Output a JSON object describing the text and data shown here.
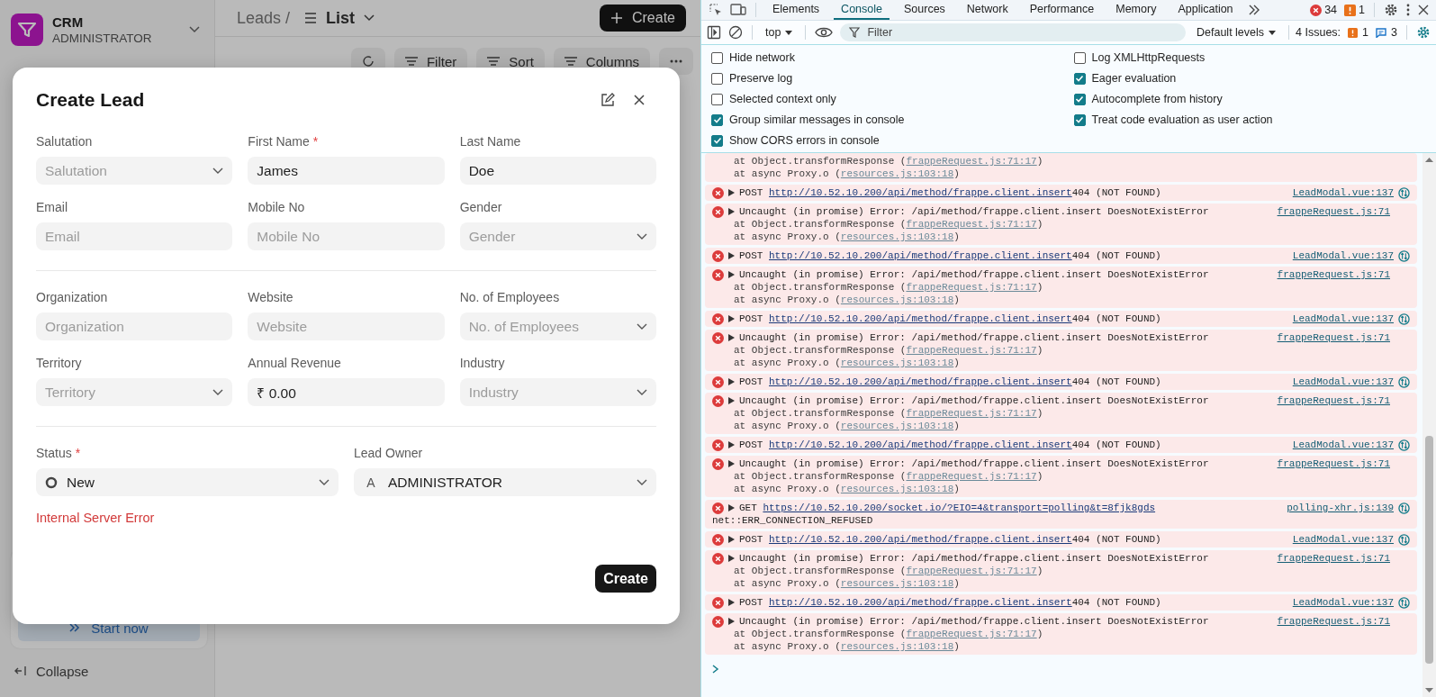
{
  "sidebar": {
    "app_name": "CRM",
    "user": "ADMINISTRATOR",
    "start_now": "Start now",
    "collapse": "Collapse"
  },
  "header": {
    "breadcrumb": "Leads /",
    "view": "List",
    "create": "Create"
  },
  "toolbar": [
    {
      "label": "Filter"
    },
    {
      "label": "Sort"
    },
    {
      "label": "Columns"
    }
  ],
  "dialog": {
    "title": "Create Lead",
    "sections": [
      {
        "fields": [
          {
            "label": "Salutation",
            "kind": "select",
            "placeholder": "Salutation"
          },
          {
            "label": "First Name",
            "mark": "*",
            "kind": "text",
            "value": "James"
          },
          {
            "label": "Last Name",
            "kind": "text",
            "value": "Doe"
          },
          {
            "label": "Email",
            "kind": "text",
            "placeholder": "Email"
          },
          {
            "label": "Mobile No",
            "kind": "text",
            "placeholder": "Mobile No"
          },
          {
            "label": "Gender",
            "kind": "select",
            "placeholder": "Gender"
          }
        ]
      },
      {
        "fields": [
          {
            "label": "Organization",
            "kind": "text",
            "placeholder": "Organization"
          },
          {
            "label": "Website",
            "kind": "text",
            "placeholder": "Website"
          },
          {
            "label": "No. of Employees",
            "kind": "select",
            "placeholder": "No. of Employees"
          },
          {
            "label": "Territory",
            "kind": "select",
            "placeholder": "Territory"
          },
          {
            "label": "Annual Revenue",
            "kind": "text",
            "value": "₹ 0.00"
          },
          {
            "label": "Industry",
            "kind": "select",
            "placeholder": "Industry"
          }
        ]
      },
      {
        "fields": [
          {
            "label": "Status",
            "mark": "*",
            "kind": "status",
            "value": "New"
          },
          {
            "label": "Lead Owner",
            "kind": "user",
            "avatar": "A",
            "value": "ADMINISTRATOR"
          }
        ]
      }
    ],
    "error": "Internal Server Error",
    "submit": "Create"
  },
  "devtools": {
    "tabs": [
      {
        "label": "Elements",
        "selected": false
      },
      {
        "label": "Console",
        "selected": true
      },
      {
        "label": "Sources",
        "selected": false
      },
      {
        "label": "Network",
        "selected": false
      },
      {
        "label": "Performance",
        "selected": false
      },
      {
        "label": "Memory",
        "selected": false
      },
      {
        "label": "Application",
        "selected": false
      }
    ],
    "errors": "34",
    "warnings": "1",
    "context": "top",
    "filter_placeholder": "Filter",
    "levels": "Default levels",
    "issues_label": "4 Issues:",
    "issue_warnings": "1",
    "issue_infos": "3",
    "settings": [
      {
        "label": "Hide network",
        "checked": false
      },
      {
        "label": "Log XMLHttpRequests",
        "checked": false
      },
      {
        "label": "Preserve log",
        "checked": false
      },
      {
        "label": "Eager evaluation",
        "checked": true
      },
      {
        "label": "Selected context only",
        "checked": false
      },
      {
        "label": "Autocomplete from history",
        "checked": true
      },
      {
        "label": "Group similar messages in console",
        "checked": true
      },
      {
        "label": "Treat code evaluation as user action",
        "checked": true
      },
      {
        "label": "Show CORS errors in console",
        "checked": true
      }
    ],
    "messages": [
      {
        "kind": "stack",
        "stack": [
          {
            "prefix": "at Object.transformResponse (",
            "link": "frappeRequest.js:71:17",
            "suffix": ")"
          },
          {
            "prefix": "at async Proxy.o (",
            "link": "resources.js:103:18",
            "suffix": ")"
          }
        ]
      },
      {
        "kind": "request",
        "method": "POST",
        "url": "http://10.52.10.200/api/method/frappe.client.insert",
        "status": "404 (NOT FOUND)",
        "source": "LeadModal.vue:137"
      },
      {
        "kind": "exception",
        "text": "Uncaught (in promise) Error: /api/method/frappe.client.insert DoesNotExistError",
        "source": "frappeRequest.js:71",
        "stack": [
          {
            "prefix": "at Object.transformResponse (",
            "link": "frappeRequest.js:71:17",
            "suffix": ")"
          },
          {
            "prefix": "at async Proxy.o (",
            "link": "resources.js:103:18",
            "suffix": ")"
          }
        ]
      },
      {
        "kind": "request",
        "method": "POST",
        "url": "http://10.52.10.200/api/method/frappe.client.insert",
        "status": "404 (NOT FOUND)",
        "source": "LeadModal.vue:137"
      },
      {
        "kind": "exception",
        "text": "Uncaught (in promise) Error: /api/method/frappe.client.insert DoesNotExistError",
        "source": "frappeRequest.js:71",
        "stack": [
          {
            "prefix": "at Object.transformResponse (",
            "link": "frappeRequest.js:71:17",
            "suffix": ")"
          },
          {
            "prefix": "at async Proxy.o (",
            "link": "resources.js:103:18",
            "suffix": ")"
          }
        ]
      },
      {
        "kind": "request",
        "method": "POST",
        "url": "http://10.52.10.200/api/method/frappe.client.insert",
        "status": "404 (NOT FOUND)",
        "source": "LeadModal.vue:137"
      },
      {
        "kind": "exception",
        "text": "Uncaught (in promise) Error: /api/method/frappe.client.insert DoesNotExistError",
        "source": "frappeRequest.js:71",
        "stack": [
          {
            "prefix": "at Object.transformResponse (",
            "link": "frappeRequest.js:71:17",
            "suffix": ")"
          },
          {
            "prefix": "at async Proxy.o (",
            "link": "resources.js:103:18",
            "suffix": ")"
          }
        ]
      },
      {
        "kind": "request",
        "method": "POST",
        "url": "http://10.52.10.200/api/method/frappe.client.insert",
        "status": "404 (NOT FOUND)",
        "source": "LeadModal.vue:137"
      },
      {
        "kind": "exception",
        "text": "Uncaught (in promise) Error: /api/method/frappe.client.insert DoesNotExistError",
        "source": "frappeRequest.js:71",
        "stack": [
          {
            "prefix": "at Object.transformResponse (",
            "link": "frappeRequest.js:71:17",
            "suffix": ")"
          },
          {
            "prefix": "at async Proxy.o (",
            "link": "resources.js:103:18",
            "suffix": ")"
          }
        ]
      },
      {
        "kind": "request",
        "method": "POST",
        "url": "http://10.52.10.200/api/method/frappe.client.insert",
        "status": "404 (NOT FOUND)",
        "source": "LeadModal.vue:137"
      },
      {
        "kind": "exception",
        "text": "Uncaught (in promise) Error: /api/method/frappe.client.insert DoesNotExistError",
        "source": "frappeRequest.js:71",
        "stack": [
          {
            "prefix": "at Object.transformResponse (",
            "link": "frappeRequest.js:71:17",
            "suffix": ")"
          },
          {
            "prefix": "at async Proxy.o (",
            "link": "resources.js:103:18",
            "suffix": ")"
          }
        ]
      },
      {
        "kind": "request",
        "method": "GET",
        "url": "https://10.52.10.200/socket.io/?EIO=4&transport=polling&t=8fjk8gds",
        "source": "polling-xhr.js:139",
        "detail": "net::ERR_CONNECTION_REFUSED"
      },
      {
        "kind": "request",
        "method": "POST",
        "url": "http://10.52.10.200/api/method/frappe.client.insert",
        "status": "404 (NOT FOUND)",
        "source": "LeadModal.vue:137"
      },
      {
        "kind": "exception",
        "text": "Uncaught (in promise) Error: /api/method/frappe.client.insert DoesNotExistError",
        "source": "frappeRequest.js:71",
        "stack": [
          {
            "prefix": "at Object.transformResponse (",
            "link": "frappeRequest.js:71:17",
            "suffix": ")"
          },
          {
            "prefix": "at async Proxy.o (",
            "link": "resources.js:103:18",
            "suffix": ")"
          }
        ]
      },
      {
        "kind": "request",
        "method": "POST",
        "url": "http://10.52.10.200/api/method/frappe.client.insert",
        "status": "404 (NOT FOUND)",
        "source": "LeadModal.vue:137"
      },
      {
        "kind": "exception",
        "text": "Uncaught (in promise) Error: /api/method/frappe.client.insert DoesNotExistError",
        "source": "frappeRequest.js:71",
        "stack": [
          {
            "prefix": "at Object.transformResponse (",
            "link": "frappeRequest.js:71:17",
            "suffix": ")"
          },
          {
            "prefix": "at async Proxy.o (",
            "link": "resources.js:103:18",
            "suffix": ")"
          }
        ]
      }
    ]
  }
}
